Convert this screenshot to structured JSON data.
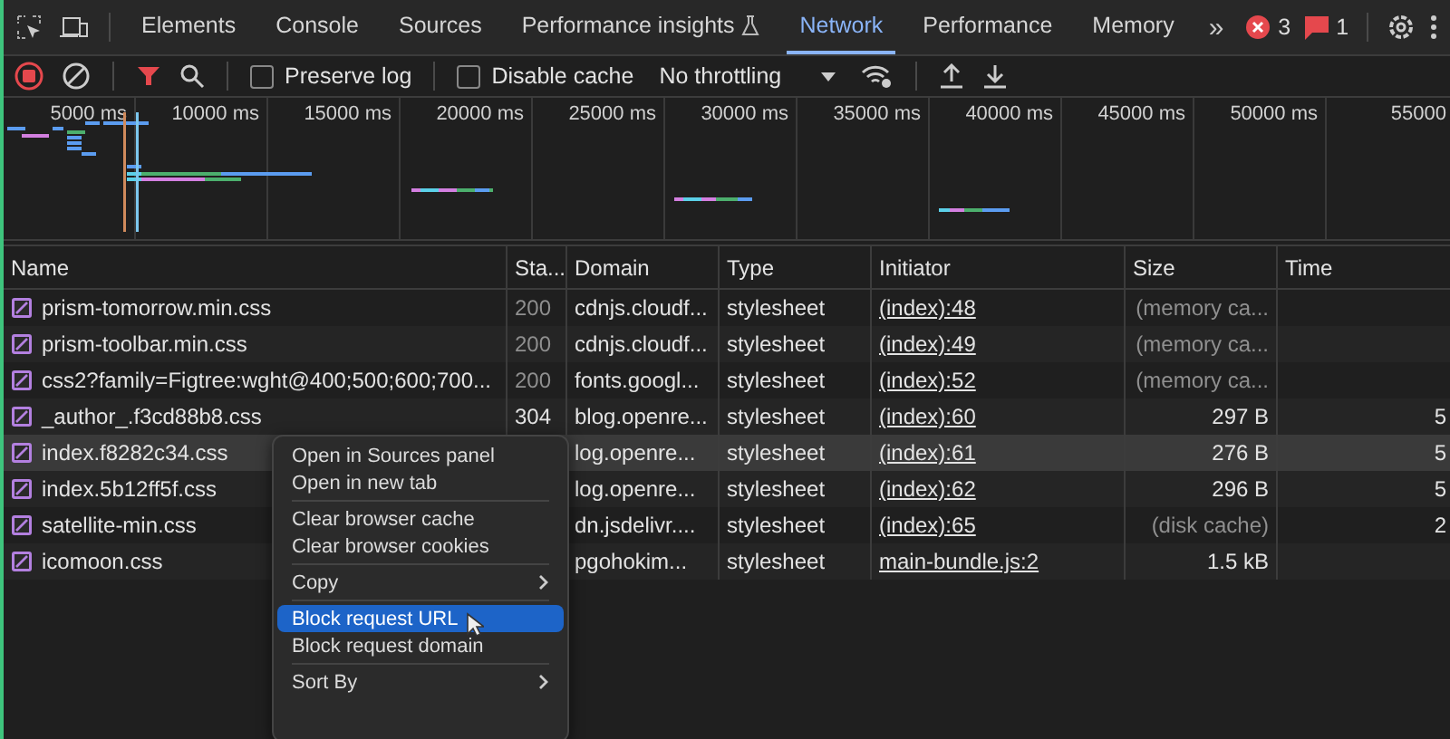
{
  "tabs": [
    {
      "label": "Elements",
      "kind": "plain",
      "selected": false
    },
    {
      "label": "Console",
      "kind": "plain",
      "selected": false
    },
    {
      "label": "Sources",
      "kind": "plain",
      "selected": false
    },
    {
      "label": "Performance insights",
      "kind": "experimental",
      "selected": false
    },
    {
      "label": "Network",
      "kind": "plain",
      "selected": true
    },
    {
      "label": "Performance",
      "kind": "plain",
      "selected": false
    },
    {
      "label": "Memory",
      "kind": "plain",
      "selected": false
    }
  ],
  "more_tabs": "»",
  "error_count": "3",
  "message_count": "1",
  "toolbar": {
    "recording": true,
    "filter_active": true,
    "preserve_log": {
      "label": "Preserve log",
      "checked": false
    },
    "disable_cache": {
      "label": "Disable cache",
      "checked": false
    },
    "throttling": "No throttling"
  },
  "overview": {
    "ticks": [
      "5000 ms",
      "10000 ms",
      "15000 ms",
      "20000 ms",
      "25000 ms",
      "30000 ms",
      "35000 ms",
      "40000 ms",
      "45000 ms",
      "50000 ms",
      "55000"
    ]
  },
  "table": {
    "columns": [
      "Name",
      "Sta...",
      "Domain",
      "Type",
      "Initiator",
      "Size",
      "Time"
    ],
    "rows": [
      {
        "name": "prism-tomorrow.min.css",
        "status": "200",
        "domain": "cdnjs.cloudf...",
        "type": "stylesheet",
        "initiator": "(index):48",
        "initiator_link": true,
        "size": "(memory ca...",
        "cached": true,
        "time": "",
        "selected": false
      },
      {
        "name": "prism-toolbar.min.css",
        "status": "200",
        "domain": "cdnjs.cloudf...",
        "type": "stylesheet",
        "initiator": "(index):49",
        "initiator_link": true,
        "size": "(memory ca...",
        "cached": true,
        "time": "",
        "selected": false
      },
      {
        "name": "css2?family=Figtree:wght@400;500;600;700...",
        "status": "200",
        "domain": "fonts.googl...",
        "type": "stylesheet",
        "initiator": "(index):52",
        "initiator_link": true,
        "size": "(memory ca...",
        "cached": true,
        "time": "",
        "selected": false
      },
      {
        "name": "_author_.f3cd88b8.css",
        "status": "304",
        "domain": "blog.openre...",
        "type": "stylesheet",
        "initiator": "(index):60",
        "initiator_link": true,
        "size": "297 B",
        "cached": false,
        "time": "5",
        "selected": false
      },
      {
        "name": "index.f8282c34.css",
        "status": "",
        "domain": "log.openre...",
        "type": "stylesheet",
        "initiator": "(index):61",
        "initiator_link": true,
        "size": "276 B",
        "cached": false,
        "time": "5",
        "selected": true
      },
      {
        "name": "index.5b12ff5f.css",
        "status": "",
        "domain": "log.openre...",
        "type": "stylesheet",
        "initiator": "(index):62",
        "initiator_link": true,
        "size": "296 B",
        "cached": false,
        "time": "5",
        "selected": false
      },
      {
        "name": "satellite-min.css",
        "status": "",
        "domain": "dn.jsdelivr....",
        "type": "stylesheet",
        "initiator": "(index):65",
        "initiator_link": true,
        "size": "(disk cache)",
        "cached": true,
        "time": "2",
        "selected": false
      },
      {
        "name": "icomoon.css",
        "status": "",
        "domain": "pgohokim...",
        "type": "stylesheet",
        "initiator": "main-bundle.js:2",
        "initiator_link": true,
        "size": "1.5 kB",
        "cached": false,
        "time": "",
        "selected": false
      }
    ]
  },
  "context_menu": [
    {
      "kind": "item",
      "label": "Open in Sources panel",
      "submenu": false,
      "selected": false
    },
    {
      "kind": "item",
      "label": "Open in new tab",
      "submenu": false,
      "selected": false
    },
    {
      "kind": "separator"
    },
    {
      "kind": "item",
      "label": "Clear browser cache",
      "submenu": false,
      "selected": false
    },
    {
      "kind": "item",
      "label": "Clear browser cookies",
      "submenu": false,
      "selected": false
    },
    {
      "kind": "separator"
    },
    {
      "kind": "item",
      "label": "Copy",
      "submenu": true,
      "selected": false
    },
    {
      "kind": "separator"
    },
    {
      "kind": "item",
      "label": "Block request URL",
      "submenu": false,
      "selected": true
    },
    {
      "kind": "item",
      "label": "Block request domain",
      "submenu": false,
      "selected": false
    },
    {
      "kind": "separator"
    },
    {
      "kind": "item",
      "label": "Sort By",
      "submenu": true,
      "selected": false
    }
  ]
}
